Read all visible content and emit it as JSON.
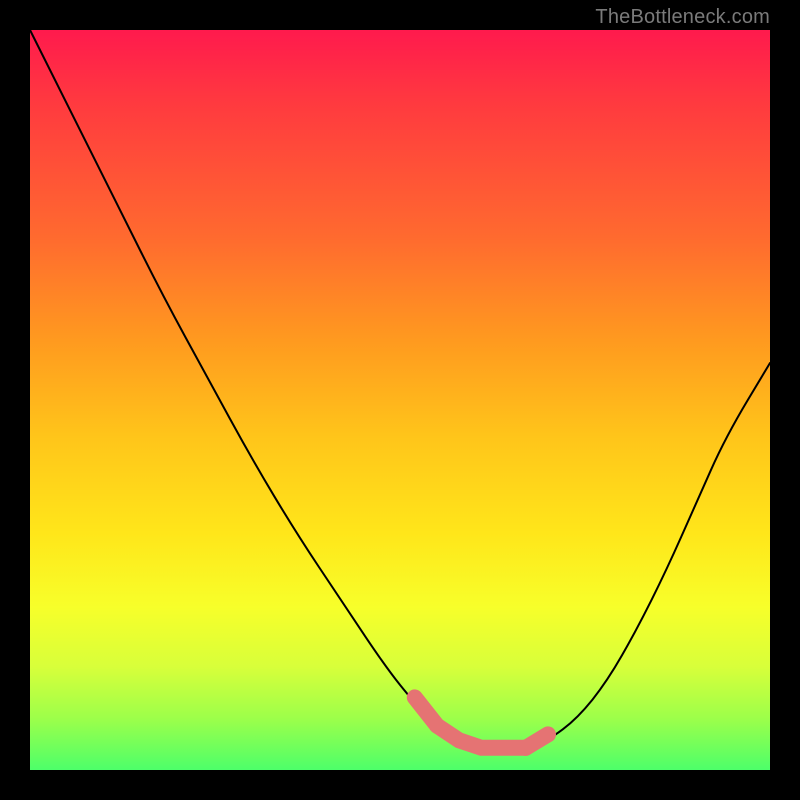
{
  "watermark": "TheBottleneck.com",
  "colors": {
    "gradient_top": "#ff1a4d",
    "gradient_mid_upper": "#ff9a1f",
    "gradient_mid_lower": "#ffe61a",
    "gradient_bottom": "#4dff6a",
    "curve": "#000000",
    "highlight": "#e57373",
    "background": "#000000"
  },
  "chart_data": {
    "type": "line",
    "title": "",
    "xlabel": "",
    "ylabel": "",
    "xlim": [
      0,
      100
    ],
    "ylim": [
      0,
      100
    ],
    "grid": false,
    "legend": false,
    "x": [
      0,
      6,
      12,
      18,
      24,
      30,
      36,
      42,
      48,
      52,
      55,
      58,
      61,
      64,
      67,
      70,
      74,
      78,
      82,
      86,
      90,
      94,
      100
    ],
    "values": [
      100,
      88,
      76,
      64,
      53,
      42,
      32,
      23,
      14,
      9,
      6,
      4,
      3,
      3,
      3,
      4,
      7,
      12,
      19,
      27,
      36,
      45,
      55
    ],
    "highlight_range_x": [
      52,
      70
    ],
    "note": "V-shaped bottleneck curve; values estimated from pixel positions (0 = bottom/green, 100 = top/red)."
  }
}
